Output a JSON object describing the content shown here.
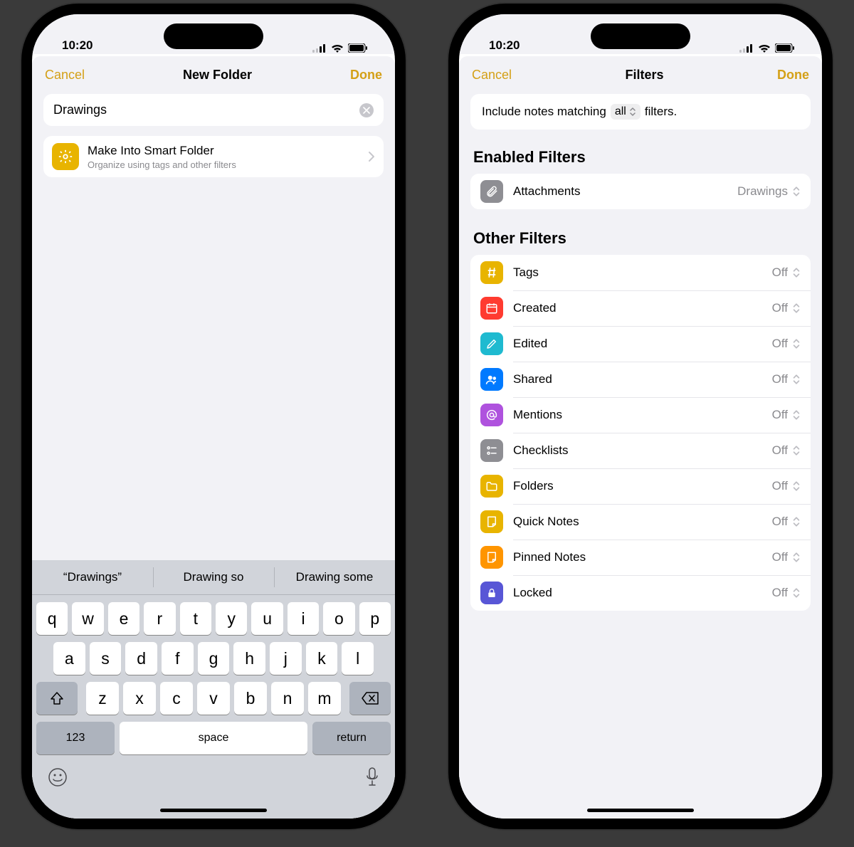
{
  "status": {
    "time": "10:20"
  },
  "left": {
    "cancel": "Cancel",
    "title": "New Folder",
    "done": "Done",
    "folder_name": "Drawings",
    "smart": {
      "title": "Make Into Smart Folder",
      "subtitle": "Organize using tags and other filters"
    },
    "suggestions": [
      "“Drawings”",
      "Drawing so",
      "Drawing some"
    ],
    "row1": [
      "q",
      "w",
      "e",
      "r",
      "t",
      "y",
      "u",
      "i",
      "o",
      "p"
    ],
    "row2": [
      "a",
      "s",
      "d",
      "f",
      "g",
      "h",
      "j",
      "k",
      "l"
    ],
    "row3": [
      "z",
      "x",
      "c",
      "v",
      "b",
      "n",
      "m"
    ],
    "num_key": "123",
    "space_key": "space",
    "return_key": "return"
  },
  "right": {
    "cancel": "Cancel",
    "title": "Filters",
    "done": "Done",
    "match_pre": "Include notes matching",
    "match_mode": "all",
    "match_post": "filters.",
    "enabled_header": "Enabled Filters",
    "enabled": [
      {
        "icon": "paperclip",
        "color": "#8e8e93",
        "label": "Attachments",
        "value": "Drawings"
      }
    ],
    "other_header": "Other Filters",
    "other": [
      {
        "icon": "hash",
        "color": "#e8b400",
        "label": "Tags",
        "value": "Off"
      },
      {
        "icon": "calendar",
        "color": "#ff3b30",
        "label": "Created",
        "value": "Off"
      },
      {
        "icon": "pencil",
        "color": "#1fbad0",
        "label": "Edited",
        "value": "Off"
      },
      {
        "icon": "shared",
        "color": "#007aff",
        "label": "Shared",
        "value": "Off"
      },
      {
        "icon": "at",
        "color": "#af52de",
        "label": "Mentions",
        "value": "Off"
      },
      {
        "icon": "checklist",
        "color": "#8e8e93",
        "label": "Checklists",
        "value": "Off"
      },
      {
        "icon": "folder",
        "color": "#e8b400",
        "label": "Folders",
        "value": "Off"
      },
      {
        "icon": "quicknote",
        "color": "#e8b400",
        "label": "Quick Notes",
        "value": "Off"
      },
      {
        "icon": "pin",
        "color": "#ff9500",
        "label": "Pinned Notes",
        "value": "Off"
      },
      {
        "icon": "lock",
        "color": "#5856d6",
        "label": "Locked",
        "value": "Off"
      }
    ]
  }
}
